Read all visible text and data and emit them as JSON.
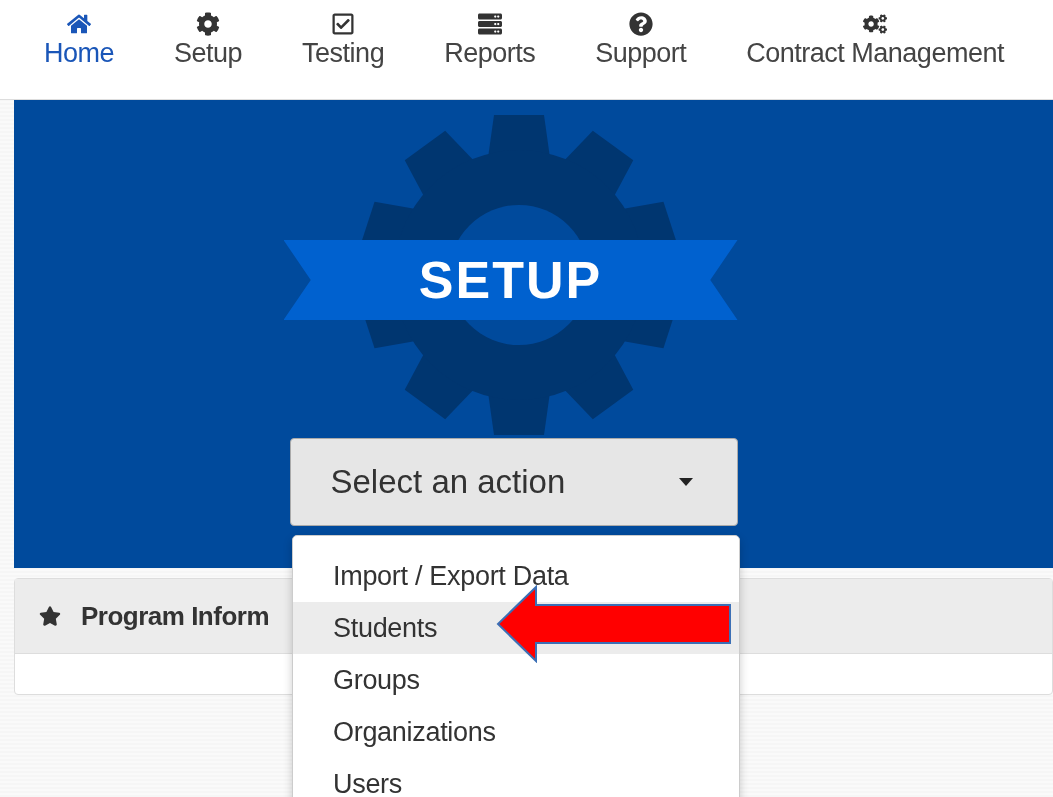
{
  "nav": [
    {
      "label": "Home",
      "selected": true
    },
    {
      "label": "Setup",
      "selected": false
    },
    {
      "label": "Testing",
      "selected": false
    },
    {
      "label": "Reports",
      "selected": false
    },
    {
      "label": "Support",
      "selected": false
    },
    {
      "label": "Contract Management",
      "selected": false
    }
  ],
  "hero": {
    "title": "SETUP",
    "select": {
      "value": "Select an action",
      "expanded": true
    }
  },
  "menu": [
    {
      "label": "Import / Export Data",
      "selected": false
    },
    {
      "label": "Students",
      "selected": true
    },
    {
      "label": "Groups",
      "selected": false
    },
    {
      "label": "Organizations",
      "selected": false
    },
    {
      "label": "Users",
      "selected": false
    }
  ],
  "panel": {
    "title": "Program Inform"
  }
}
